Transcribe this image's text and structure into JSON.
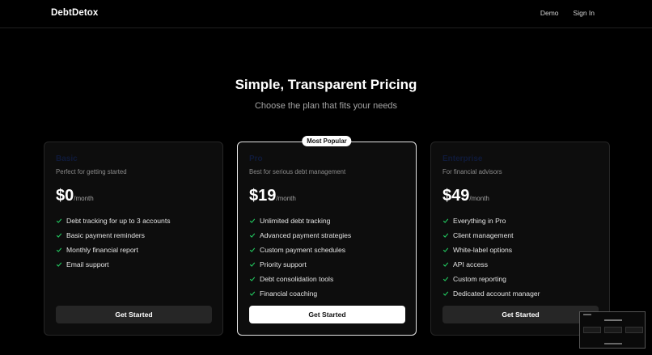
{
  "header": {
    "brand": "DebtDetox",
    "nav": [
      "Demo",
      "Sign In"
    ]
  },
  "hero": {
    "title": "Simple, Transparent Pricing",
    "subtitle": "Choose the plan that fits your needs"
  },
  "plans": [
    {
      "name": "Basic",
      "description": "Perfect for getting started",
      "price": "$0",
      "period": "/month",
      "features": [
        "Debt tracking for up to 3 accounts",
        "Basic payment reminders",
        "Monthly financial report",
        "Email support"
      ],
      "cta": "Get Started"
    },
    {
      "name": "Pro",
      "badge": "Most Popular",
      "description": "Best for serious debt management",
      "price": "$19",
      "period": "/month",
      "features": [
        "Unlimited debt tracking",
        "Advanced payment strategies",
        "Custom payment schedules",
        "Priority support",
        "Debt consolidation tools",
        "Financial coaching"
      ],
      "cta": "Get Started"
    },
    {
      "name": "Enterprise",
      "description": "For financial advisors",
      "price": "$49",
      "period": "/month",
      "features": [
        "Everything in Pro",
        "Client management",
        "White-label options",
        "API access",
        "Custom reporting",
        "Dedicated account manager"
      ],
      "cta": "Get Started"
    }
  ],
  "colors": {
    "check": "#22c55e",
    "background": "#000000"
  },
  "icons": {
    "feature": "check-icon"
  }
}
